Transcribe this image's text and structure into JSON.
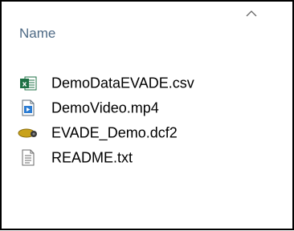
{
  "header": {
    "column_label": "Name",
    "sort_direction": "ascending"
  },
  "files": [
    {
      "name": "DemoDataEVADE.csv",
      "icon": "excel-csv-icon"
    },
    {
      "name": "DemoVideo.mp4",
      "icon": "video-file-icon"
    },
    {
      "name": "EVADE_Demo.dcf2",
      "icon": "dcf2-file-icon"
    },
    {
      "name": "README.txt",
      "icon": "text-file-icon"
    }
  ],
  "colors": {
    "header_text": "#4e6a85",
    "excel_green": "#1e7145",
    "video_blue": "#2b7cd3",
    "dcf_gold": "#c9a21a",
    "border": "#000000"
  }
}
